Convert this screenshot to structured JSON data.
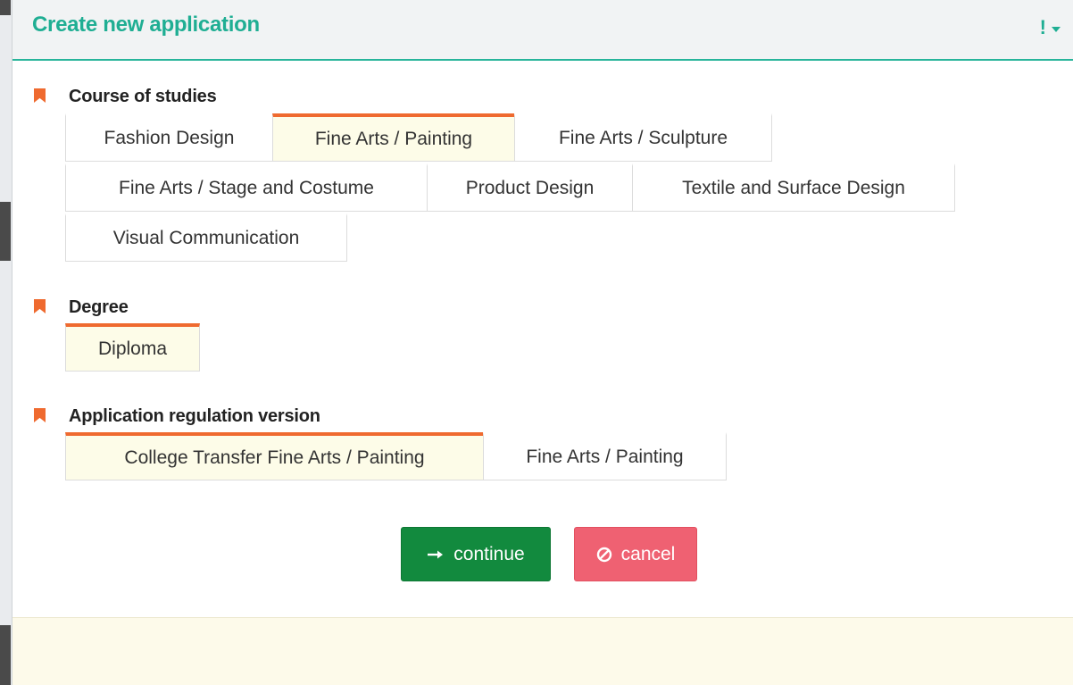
{
  "dialog": {
    "title": "Create new application",
    "menu_icon": "exclamation-icon"
  },
  "course_section": {
    "label": "Course of studies",
    "selected": "Fine Arts / Painting",
    "options": [
      "Fashion Design",
      "Fine Arts / Painting",
      "Fine Arts / Sculpture",
      "Fine Arts / Stage and Costume",
      "Product Design",
      "Textile and Surface Design",
      "Visual Communication"
    ]
  },
  "degree_section": {
    "label": "Degree",
    "selected": "Diploma",
    "options": [
      "Diploma"
    ]
  },
  "regulation_section": {
    "label": "Application regulation version",
    "selected": "College Transfer Fine Arts / Painting",
    "options": [
      "College Transfer Fine Arts / Painting",
      "Fine Arts / Painting"
    ]
  },
  "buttons": {
    "continue_label": "continue",
    "cancel_label": "cancel"
  },
  "colors": {
    "accent": "#1fae93",
    "selected_marker": "#ef6a2f",
    "continue": "#128a3e",
    "cancel": "#ef6172"
  }
}
